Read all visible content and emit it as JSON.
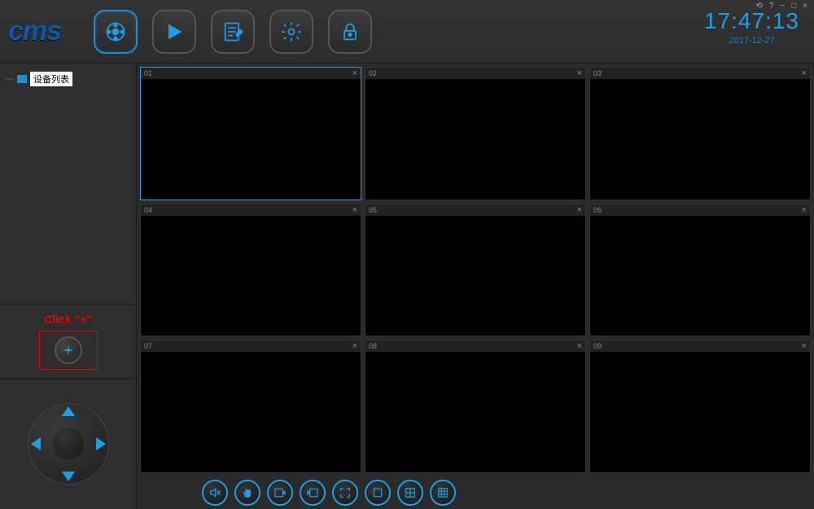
{
  "app": {
    "name": "cms"
  },
  "clock": {
    "time": "17:47:13",
    "date": "2017-12-27"
  },
  "sidebar": {
    "tree_root": "设备列表",
    "hint": "Click \"+\""
  },
  "grid": {
    "cells": [
      {
        "id": "01",
        "selected": true
      },
      {
        "id": "02",
        "selected": false
      },
      {
        "id": "03",
        "selected": false
      },
      {
        "id": "04",
        "selected": false
      },
      {
        "id": "05",
        "selected": false
      },
      {
        "id": "06",
        "selected": false
      },
      {
        "id": "07",
        "selected": false
      },
      {
        "id": "08",
        "selected": false
      },
      {
        "id": "09",
        "selected": false
      }
    ]
  },
  "colors": {
    "accent": "#1a9fe8",
    "hint": "#e00000"
  },
  "icons": {
    "header": [
      "record-icon",
      "play-icon",
      "edit-icon",
      "settings-icon",
      "lock-icon"
    ],
    "toolbar": [
      "mute-icon",
      "hand-icon",
      "capture-in-icon",
      "capture-out-icon",
      "fullscreen-icon",
      "layout-1-icon",
      "layout-4-icon",
      "layout-9-icon"
    ]
  }
}
